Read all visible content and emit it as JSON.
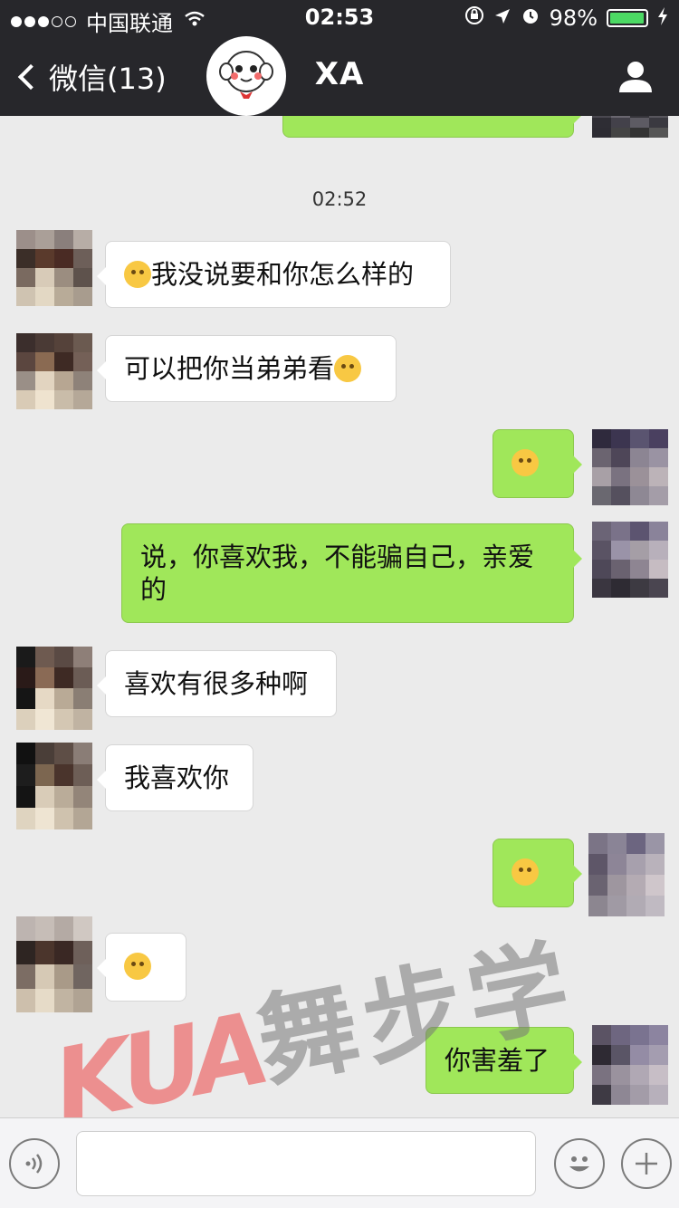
{
  "status_bar": {
    "carrier": "中国联通",
    "time": "02:53",
    "battery": "98%",
    "battery_level": 0.98,
    "signal_bars": 3,
    "signal_total": 5
  },
  "nav": {
    "back_label": "微信(13)",
    "title": "XA"
  },
  "messages": [
    {
      "type": "timestamp",
      "text": "02:52"
    },
    {
      "side": "in",
      "emoji_before": "flushed-face",
      "text": "我没说要和你怎么样的"
    },
    {
      "side": "in",
      "text": "可以把你当弟弟看",
      "emoji_after": "thinking-face"
    },
    {
      "side": "out",
      "emoji_only": "rolling-eyes-face"
    },
    {
      "side": "out",
      "text": "说，你喜欢我，不能骗自己，亲爱的"
    },
    {
      "side": "in",
      "text": "喜欢有很多种啊"
    },
    {
      "side": "in",
      "text": "我喜欢你"
    },
    {
      "side": "out",
      "emoji_only": "rolling-eyes-face"
    },
    {
      "side": "in",
      "emoji_only": "thinking-face"
    },
    {
      "side": "out",
      "text": "你害羞了"
    }
  ],
  "input_bar": {
    "voice_icon": "voice-icon",
    "emoji_icon": "smiley-icon",
    "add_icon": "plus-icon"
  },
  "watermark": {
    "logo": "KUA",
    "text": "舞步学院"
  },
  "colors": {
    "header_bg": "#27272b",
    "chat_bg": "#ebebeb",
    "bubble_out": "#a0e75a",
    "bubble_in": "#ffffff",
    "battery": "#4cd964"
  }
}
